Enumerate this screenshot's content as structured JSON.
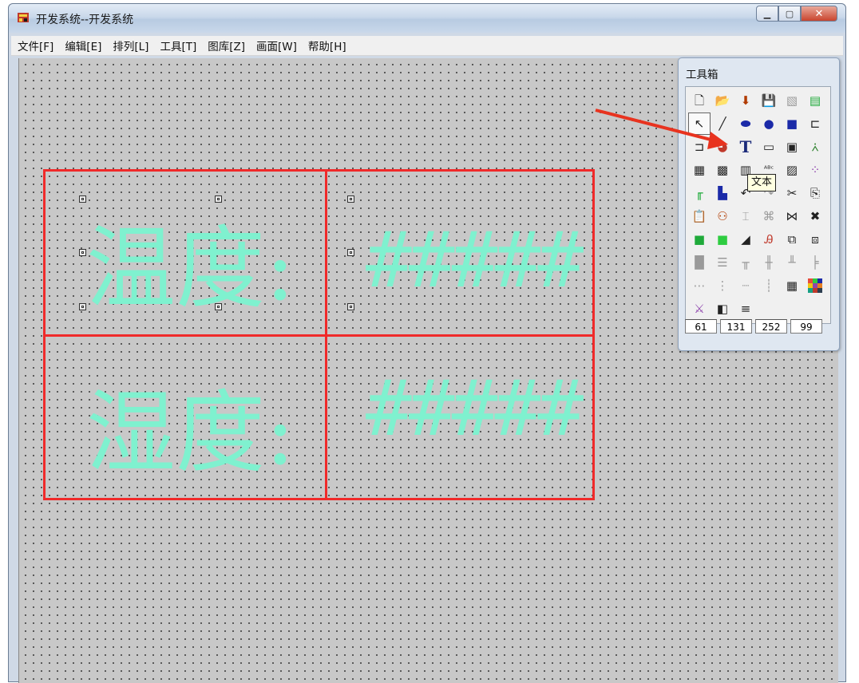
{
  "window": {
    "title": "开发系统--开发系统",
    "controls": {
      "minimize": "▁",
      "maximize": "▢",
      "close": "✕"
    }
  },
  "menu": [
    {
      "label": "文件[F]"
    },
    {
      "label": "编辑[E]"
    },
    {
      "label": "排列[L]"
    },
    {
      "label": "工具[T]"
    },
    {
      "label": "图库[Z]"
    },
    {
      "label": "画面[W]"
    },
    {
      "label": "帮助[H]"
    }
  ],
  "canvas": {
    "cells": [
      {
        "label": "温度:",
        "value": "#####"
      },
      {
        "label": "湿度:",
        "value": "#####"
      }
    ],
    "colors": {
      "border": "#f02a2a",
      "text": "#7ff1cf",
      "grid": "#c8c8c8"
    }
  },
  "toolbox": {
    "title": "工具箱",
    "selected_tool": "text-tool",
    "tooltip": "文本",
    "values": [
      "61",
      "131",
      "252",
      "99"
    ]
  }
}
